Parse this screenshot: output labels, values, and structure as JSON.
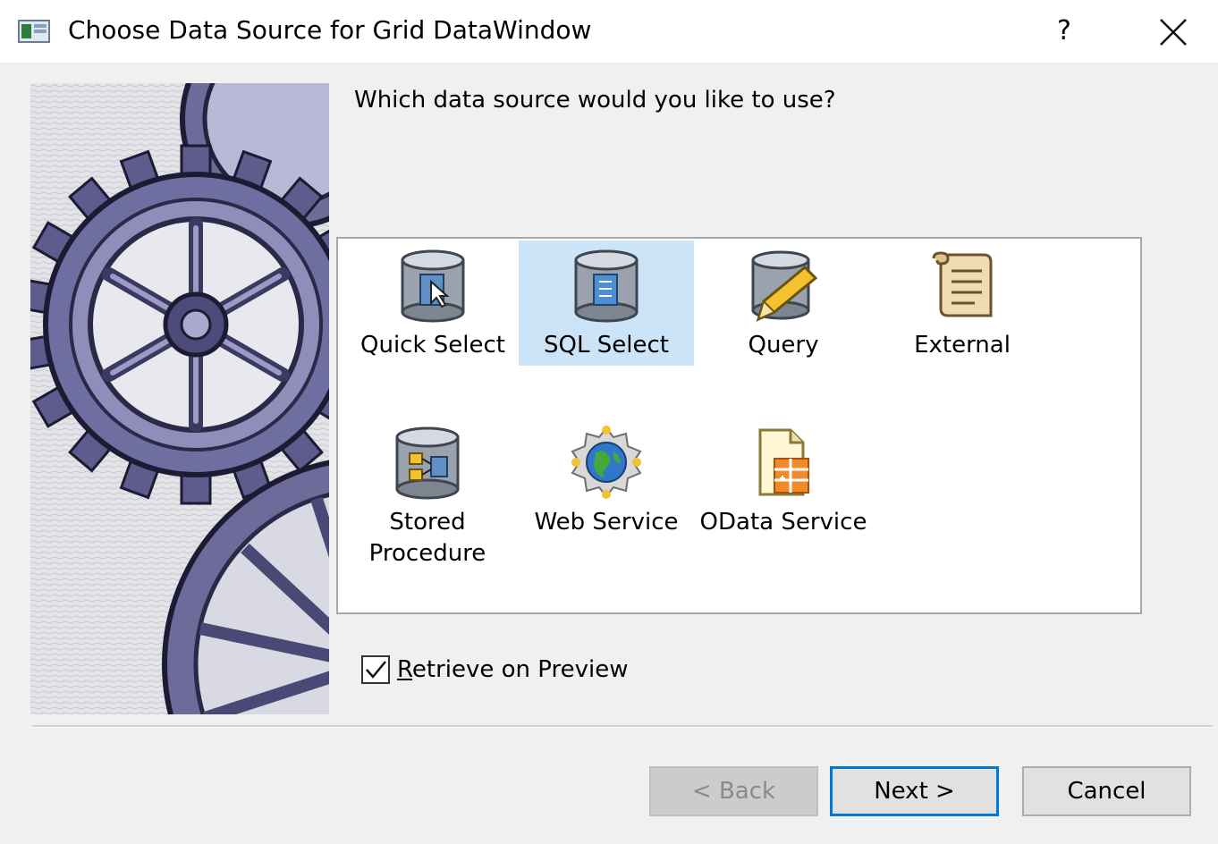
{
  "window": {
    "title": "Choose Data Source for Grid DataWindow",
    "help_label": "?",
    "close_icon": "close-icon",
    "app_icon": "datawindow-app-icon"
  },
  "main": {
    "question": "Which data source would you like to use?",
    "image": "gears-illustration",
    "sources": [
      {
        "label": "Quick Select",
        "icon": "quick-select-database-icon",
        "selected": false
      },
      {
        "label": "SQL Select",
        "icon": "sql-select-database-icon",
        "selected": true
      },
      {
        "label": "Query",
        "icon": "query-database-pencil-icon",
        "selected": false
      },
      {
        "label": "External",
        "icon": "external-scroll-icon",
        "selected": false
      },
      {
        "label": "Stored\nProcedure",
        "icon": "stored-procedure-database-icon",
        "selected": false
      },
      {
        "label": "Web Service",
        "icon": "web-service-globe-icon",
        "selected": false
      },
      {
        "label": "OData Service",
        "icon": "odata-service-document-icon",
        "selected": false
      }
    ],
    "retrieve_checkbox": {
      "label_mnemonic": "R",
      "label_rest": "etrieve on Preview",
      "checked": true
    }
  },
  "footer": {
    "back_label": "< Back",
    "back_enabled": false,
    "next_label": "Next >",
    "cancel_label": "Cancel"
  },
  "colors": {
    "selection": "#cce4f7",
    "default_button_border": "#0078d7",
    "dialog_background": "#f0f0f0"
  }
}
